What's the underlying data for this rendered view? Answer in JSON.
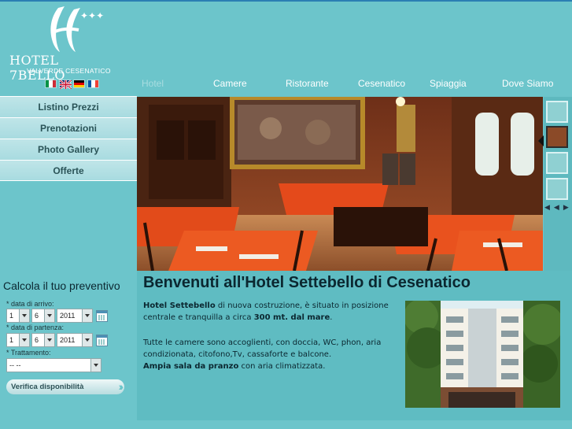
{
  "logo": {
    "title": "HOTEL 7BELLO",
    "subtitle": "VALVERDE CESENATICO"
  },
  "languages": [
    {
      "name": "italian-flag-icon",
      "colors": [
        "#009246",
        "#ffffff",
        "#ce2b37"
      ]
    },
    {
      "name": "english-flag-icon",
      "colors": [
        "#012169",
        "#ffffff",
        "#c8102e"
      ]
    },
    {
      "name": "german-flag-icon",
      "colors": [
        "#000000",
        "#dd0000",
        "#ffce00"
      ]
    },
    {
      "name": "french-flag-icon",
      "colors": [
        "#0055a4",
        "#ffffff",
        "#ef4135"
      ]
    }
  ],
  "topnav": {
    "items": [
      "Hotel",
      "Camere",
      "Ristorante",
      "Cesenatico",
      "Spiaggia",
      "Dove Siamo"
    ],
    "active": "Hotel"
  },
  "leftmenu": {
    "items": [
      "Listino Prezzi",
      "Prenotazioni",
      "Photo Gallery",
      "Offerte"
    ]
  },
  "quote": {
    "title": "Calcola il tuo preventivo",
    "arrival_label": "* data di arrivo:",
    "departure_label": "* data di partenza:",
    "treatment_label": "* Trattamento:",
    "arrival": {
      "day": "1",
      "month": "6",
      "year": "2011"
    },
    "departure": {
      "day": "1",
      "month": "6",
      "year": "2011"
    },
    "treatment_value": "-- --",
    "verify_label": "Verifica disponibilità"
  },
  "content": {
    "headline": "Benvenuti all'Hotel Settebello di Cesenatico",
    "p1_bold1": "Hotel Settebello",
    "p1_text1": " di nuova costruzione, è situato in posizione centrale e tranquilla a circa ",
    "p1_bold2": "300 mt. dal mare",
    "p1_text2": ".",
    "p2_text": "Tutte le camere sono accoglienti, con doccia, WC, phon, aria condizionata, citofono,Tv, cassaforte e balcone.",
    "p3_bold": "Ampia sala da pranzo",
    "p3_text": " con aria climatizzata."
  },
  "gallery": {
    "prev_label": "◀◀",
    "next_label": "▶▶"
  },
  "colors": {
    "background": "#6cc5cb",
    "content_bg": "#5fbcc2",
    "menu_item": "#bfe5e8",
    "nav_active": "#a8dde0"
  }
}
